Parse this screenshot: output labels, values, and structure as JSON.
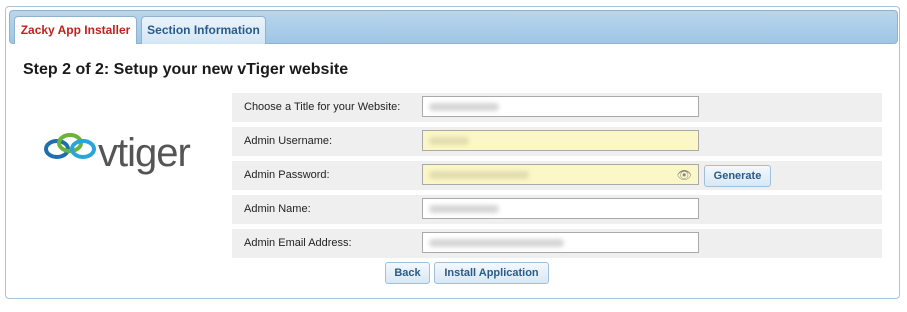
{
  "tabs": [
    {
      "label": "Zacky App Installer",
      "active": true
    },
    {
      "label": "Section Information",
      "active": false
    }
  ],
  "page_title": "Step 2 of 2: Setup your new vTiger website",
  "logo": {
    "text": "vtiger",
    "icon": "vtiger-logo-icon"
  },
  "form": {
    "title_label": "Choose a Title for your Website:",
    "username_label": "Admin Username:",
    "password_label": "Admin Password:",
    "name_label": "Admin Name:",
    "email_label": "Admin Email Address:"
  },
  "buttons": {
    "generate": "Generate",
    "back": "Back",
    "install": "Install Application"
  },
  "colors": {
    "active_tab_text": "#c21f1f",
    "button_text": "#2a5b87",
    "autofill_bg": "#fbf7c6"
  }
}
